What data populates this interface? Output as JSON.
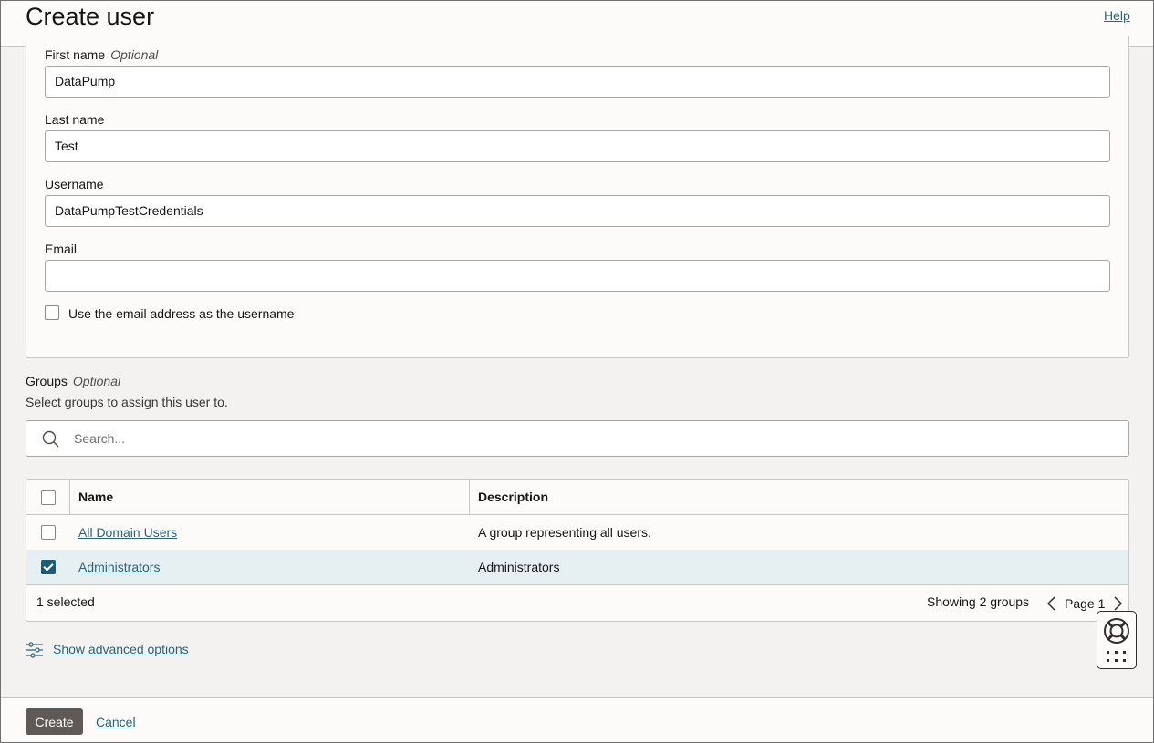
{
  "header": {
    "title": "Create user",
    "help_label": "Help"
  },
  "form": {
    "first_name": {
      "label": "First name",
      "optional": "Optional",
      "value": "DataPump"
    },
    "last_name": {
      "label": "Last name",
      "value": "Test"
    },
    "username": {
      "label": "Username",
      "value": "DataPumpTestCredentials"
    },
    "email": {
      "label": "Email",
      "value": ""
    },
    "use_email_checkbox": {
      "label": "Use the email address as the username",
      "checked": false
    }
  },
  "groups": {
    "title": "Groups",
    "optional": "Optional",
    "description": "Select groups to assign this user to.",
    "search_placeholder": "Search...",
    "columns": [
      "Name",
      "Description"
    ],
    "rows": [
      {
        "name": "All Domain Users",
        "description": "A group representing all users.",
        "selected": false
      },
      {
        "name": "Administrators",
        "description": "Administrators",
        "selected": true
      }
    ],
    "selected_count_text": "1 selected",
    "showing_text": "Showing 2 groups",
    "page_text": "Page 1"
  },
  "advanced_options_label": "Show advanced options",
  "footer": {
    "create_label": "Create",
    "cancel_label": "Cancel"
  },
  "colors": {
    "link": "#2b6478",
    "checkbox_checked": "#1d5c74",
    "selected_row": "#e6f0f2",
    "primary_button": "#5f5a55",
    "page_background": "#f3f2f0"
  }
}
